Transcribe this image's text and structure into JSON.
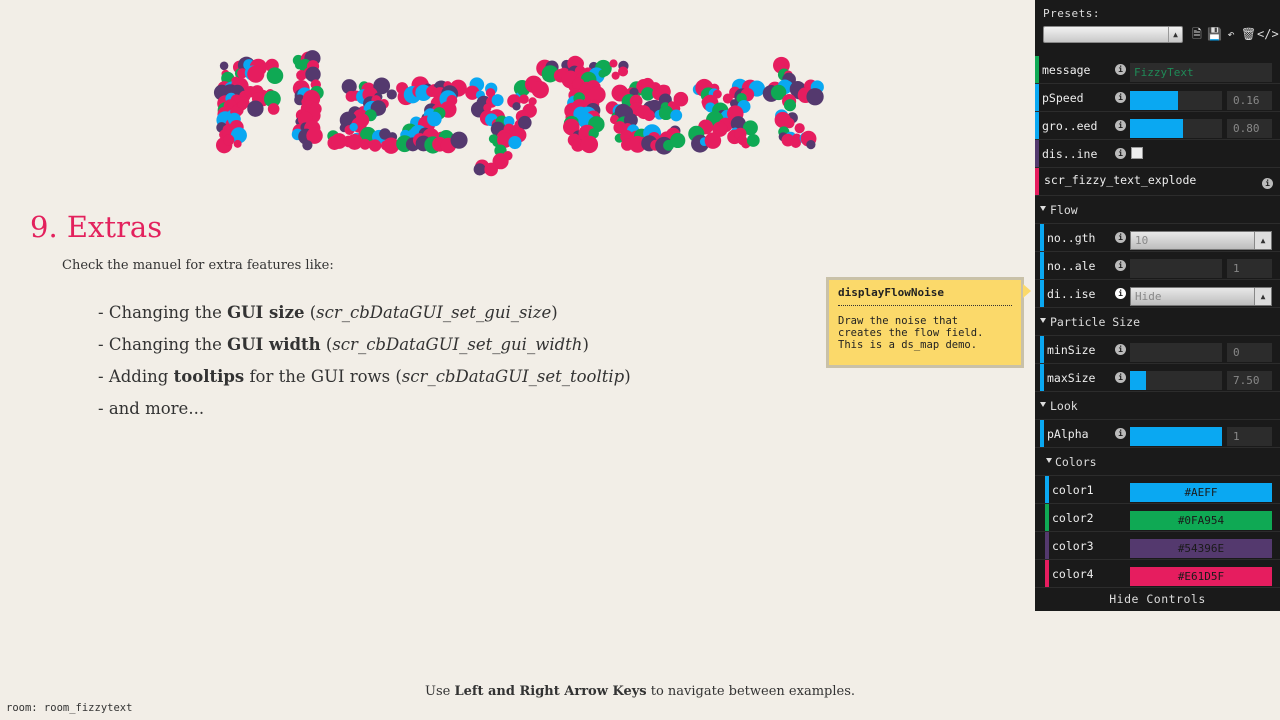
{
  "logo": {
    "text": "FizzyText"
  },
  "colors": {
    "color1": "#0aa8f2",
    "color2": "#0fa954",
    "color3": "#54396e",
    "color4": "#e61d5f"
  },
  "content": {
    "section_title": "9. Extras",
    "intro": "Check the manuel for extra features like:",
    "bullets": [
      {
        "prefix": "- Changing the ",
        "bold": "GUI size",
        "middle": " (",
        "italic": "scr_cbDataGUI_set_gui_size",
        "suffix": ")"
      },
      {
        "prefix": "- Changing the ",
        "bold": "GUI width",
        "middle": " (",
        "italic": "scr_cbDataGUI_set_gui_width",
        "suffix": ")"
      },
      {
        "prefix": "- Adding ",
        "bold": "tooltips",
        "middle": " for the GUI rows (",
        "italic": "scr_cbDataGUI_set_tooltip",
        "suffix": ")"
      },
      {
        "prefix": "- and more...",
        "bold": "",
        "middle": "",
        "italic": "",
        "suffix": ""
      }
    ]
  },
  "footer": {
    "prefix": "Use ",
    "bold": "Left and Right Arrow Keys",
    "suffix": " to navigate between examples."
  },
  "room_label": "room: room_fizzytext",
  "tooltip": {
    "title": "displayFlowNoise",
    "body": "Draw the noise that\ncreates the flow field.\nThis is a ds_map demo."
  },
  "gui": {
    "presets_label": "Presets:",
    "presets_value": "",
    "tools": [
      "new-file-icon",
      "save-icon",
      "revert-icon",
      "delete-icon",
      "code-icon"
    ],
    "message": {
      "label": "message",
      "value": "FizzyText"
    },
    "pspeed": {
      "label": "pSpeed",
      "value": "0.16",
      "fraction": 0.52
    },
    "growspeed": {
      "label": "gro..eed",
      "value": "0.80",
      "fraction": 0.58
    },
    "displayoutline": {
      "label": "dis..ine",
      "checked": false
    },
    "explode": {
      "label": "scr_fizzy_text_explode"
    },
    "flow": {
      "title": "Flow",
      "noise_strength": {
        "label": "no..gth",
        "value": "10"
      },
      "noise_scale": {
        "label": "no..ale",
        "value": "1",
        "fraction": 0
      },
      "display_noise": {
        "label": "di..ise",
        "value": "Hide"
      }
    },
    "particle_size": {
      "title": "Particle Size",
      "min": {
        "label": "minSize",
        "value": "0",
        "fraction": 0
      },
      "max": {
        "label": "maxSize",
        "value": "7.50",
        "fraction": 0.17
      }
    },
    "look": {
      "title": "Look",
      "palpha": {
        "label": "pAlpha",
        "value": "1",
        "fraction": 1
      },
      "colors_title": "Colors",
      "color1": {
        "label": "color1",
        "value": "#AEFF"
      },
      "color2": {
        "label": "color2",
        "value": "#0FA954"
      },
      "color3": {
        "label": "color3",
        "value": "#54396E"
      },
      "color4": {
        "label": "color4",
        "value": "#E61D5F"
      }
    },
    "hide_controls": "Hide Controls"
  }
}
